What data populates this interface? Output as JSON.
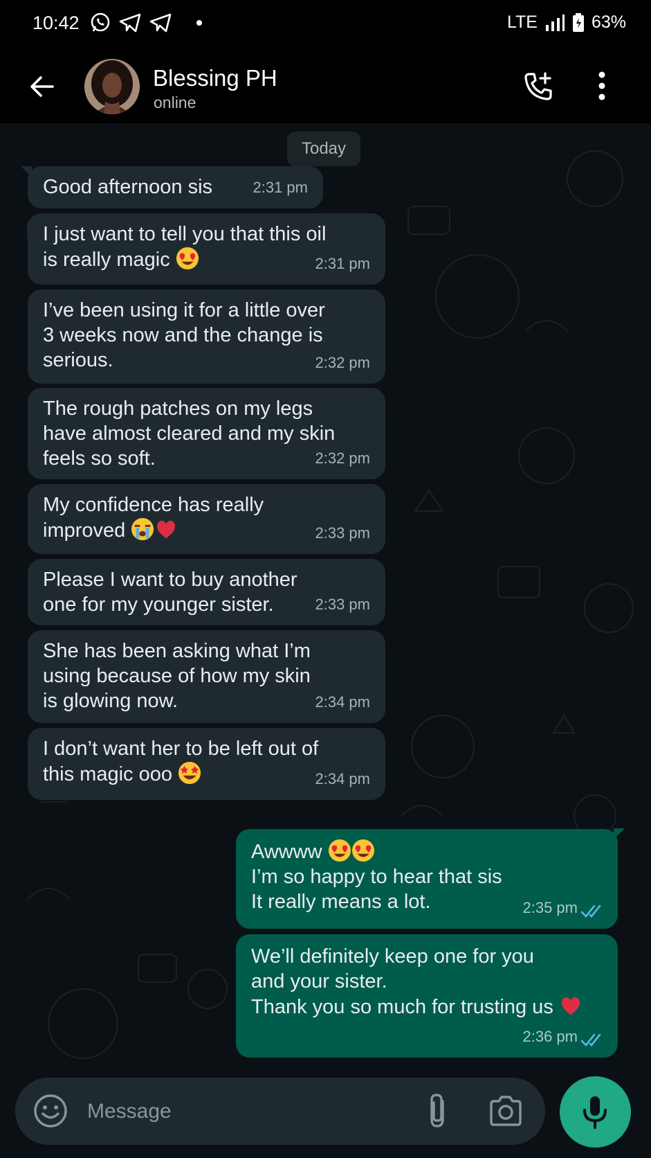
{
  "status_bar": {
    "time": "10:42",
    "network": "LTE",
    "battery": "63%",
    "icons": [
      "whatsapp-icon",
      "telegram-icon",
      "telegram-icon",
      "dot-icon",
      "signal-icon",
      "battery-icon"
    ]
  },
  "header": {
    "contact_name": "Blessing PH",
    "contact_status": "online",
    "icons": [
      "back-arrow-icon",
      "avatar",
      "add-call-icon",
      "more-vert-icon"
    ]
  },
  "chat": {
    "date_label": "Today",
    "incoming": [
      {
        "text": "Good afternoon sis",
        "time": "2:31 pm"
      },
      {
        "text": "I just want to tell you that this oil\nis really magic",
        "emoji": [
          "heart-eyes-emoji"
        ],
        "time": "2:31 pm"
      },
      {
        "text": "I’ve been using it for a little over\n3 weeks now and the change is\nserious.",
        "time": "2:32 pm"
      },
      {
        "text": "The rough patches on my legs\nhave almost cleared and my skin\nfeels so soft.",
        "time": "2:32 pm"
      },
      {
        "text": "My confidence has really\nimproved",
        "emoji": [
          "crying-emoji",
          "red-heart-emoji"
        ],
        "time": "2:33 pm"
      },
      {
        "text": "Please I want to buy another\none for my younger sister.",
        "time": "2:33 pm"
      },
      {
        "text": "She has been asking what I’m\nusing because of how my skin\nis glowing now.",
        "time": "2:34 pm"
      },
      {
        "text": "I don’t want her to be left out of\nthis magic ooo",
        "emoji": [
          "star-struck-emoji"
        ],
        "time": "2:34 pm"
      }
    ],
    "outgoing": [
      {
        "line1": "Awwww",
        "rest": "I’m so happy to hear that sis\nIt really means a lot.",
        "emoji": [
          "heart-eyes-emoji",
          "heart-eyes-emoji"
        ],
        "time": "2:35 pm",
        "status": "read"
      },
      {
        "text": "We’ll definitely keep one for you\nand your sister.\nThank you so much for trusting us",
        "emoji": [
          "red-heart-emoji"
        ],
        "time": "2:36 pm",
        "status": "read"
      }
    ]
  },
  "input": {
    "placeholder": "Message",
    "icons": [
      "emoji-icon",
      "attach-icon",
      "camera-icon",
      "mic-icon"
    ]
  },
  "colors": {
    "background": "#0b1014",
    "incoming_bubble": "#1f2a30",
    "outgoing_bubble": "#005c4b",
    "accent": "#21a884",
    "read_ticks": "#53bdeb"
  }
}
